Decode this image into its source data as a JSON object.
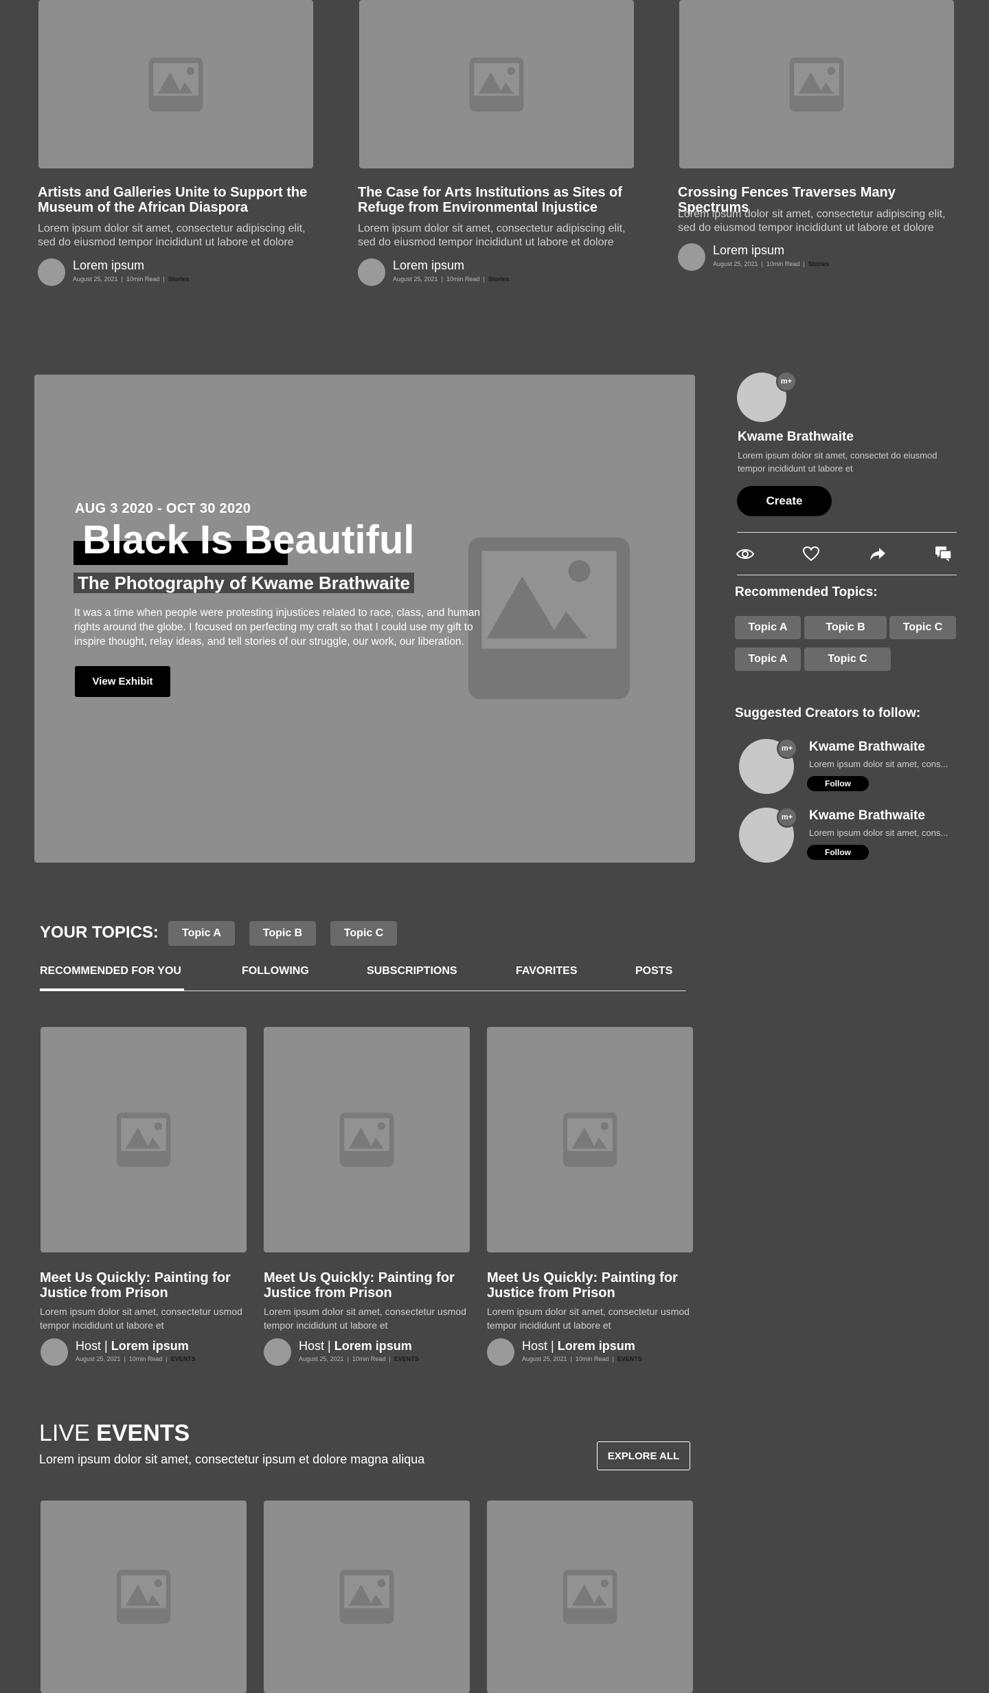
{
  "top_cards": [
    {
      "title": "Artists and Galleries Unite to Support the Museum of the African Diaspora",
      "desc": "Lorem ipsum dolor sit amet, consectetur adipiscing elit, sed do eiusmod tempor incididunt ut labore et dolore",
      "author": "Lorem ipsum",
      "date": "August 25, 2021",
      "read": "10min Read",
      "category": "Stories"
    },
    {
      "title": "The Case for Arts Institutions as Sites of Refuge from Environmental Injustice",
      "desc": "Lorem ipsum dolor sit amet, consectetur adipiscing elit, sed do eiusmod tempor incididunt ut labore et dolore",
      "author": "Lorem ipsum",
      "date": "August 25, 2021",
      "read": "10min Read",
      "category": "Stories"
    },
    {
      "title": "Crossing Fences Traverses Many Spectrums",
      "desc": "Lorem ipsum dolor sit amet, consectetur adipiscing elit, sed do eiusmod tempor incididunt ut labore et dolore",
      "author": "Lorem ipsum",
      "date": "August 25, 2021",
      "read": "10min Read",
      "category": "Stories"
    }
  ],
  "hero": {
    "dates": "AUG 3 2020 - OCT 30 2020",
    "title": "Black Is Beautiful",
    "subtitle": "The Photography of Kwame Brathwaite",
    "body": "It was a time when people were protesting injustices related to race, class, and human rights around the globe. I focused on perfecting my craft so that I could use my gift to inspire thought, relay ideas, and tell stories of our struggle, our work, our liberation.",
    "cta": "View Exhibit"
  },
  "profile": {
    "badge": "m+",
    "name": "Kwame Brathwaite",
    "bio": "Lorem ipsum dolor sit amet, consectet do eiusmod tempor incididunt ut labore et",
    "create_label": "Create",
    "recommended_heading": "Recommended Topics:",
    "topics": [
      "Topic A",
      "Topic B",
      "Topic C",
      "Topic A",
      "Topic C"
    ],
    "suggested_heading": "Suggested Creators to follow:",
    "creators": [
      {
        "name": "Kwame Brathwaite",
        "bio": "Lorem ipsum dolor sit amet, cons...",
        "follow": "Follow",
        "badge": "m+"
      },
      {
        "name": "Kwame Brathwaite",
        "bio": "Lorem ipsum dolor sit amet, cons...",
        "follow": "Follow",
        "badge": "m+"
      }
    ]
  },
  "your_topics": {
    "label": "YOUR TOPICS:",
    "chips": [
      "Topic A",
      "Topic B",
      "Topic C"
    ]
  },
  "tabs": [
    "RECOMMENDED FOR YOU",
    "FOLLOWING",
    "SUBSCRIPTIONS",
    "FAVORITES",
    "POSTS"
  ],
  "feed_cards": [
    {
      "title": "Meet Us Quickly: Painting for Justice from Prison",
      "desc": "Lorem ipsum dolor sit amet, consectetur usmod tempor incididunt ut labore et",
      "host": "Host",
      "author": "Lorem ipsum",
      "date": "August 25, 2021",
      "read": "10min Read",
      "category": "EVENTS"
    },
    {
      "title": "Meet Us Quickly: Painting for Justice from Prison",
      "desc": "Lorem ipsum dolor sit amet, consectetur usmod tempor incididunt ut labore et",
      "host": "Host",
      "author": "Lorem ipsum",
      "date": "August 25, 2021",
      "read": "10min Read",
      "category": "EVENTS"
    },
    {
      "title": "Meet Us Quickly: Painting for Justice from Prison",
      "desc": "Lorem ipsum dolor sit amet, consectetur usmod tempor incididunt ut labore et",
      "host": "Host",
      "author": "Lorem ipsum",
      "date": "August 25, 2021",
      "read": "10min Read",
      "category": "EVENTS"
    }
  ],
  "live_events": {
    "title_light": "LIVE",
    "title_bold": "EVENTS",
    "subtitle": "Lorem ipsum dolor sit amet, consectetur ipsum  et dolore magna aliqua",
    "explore": "EXPLORE ALL"
  }
}
